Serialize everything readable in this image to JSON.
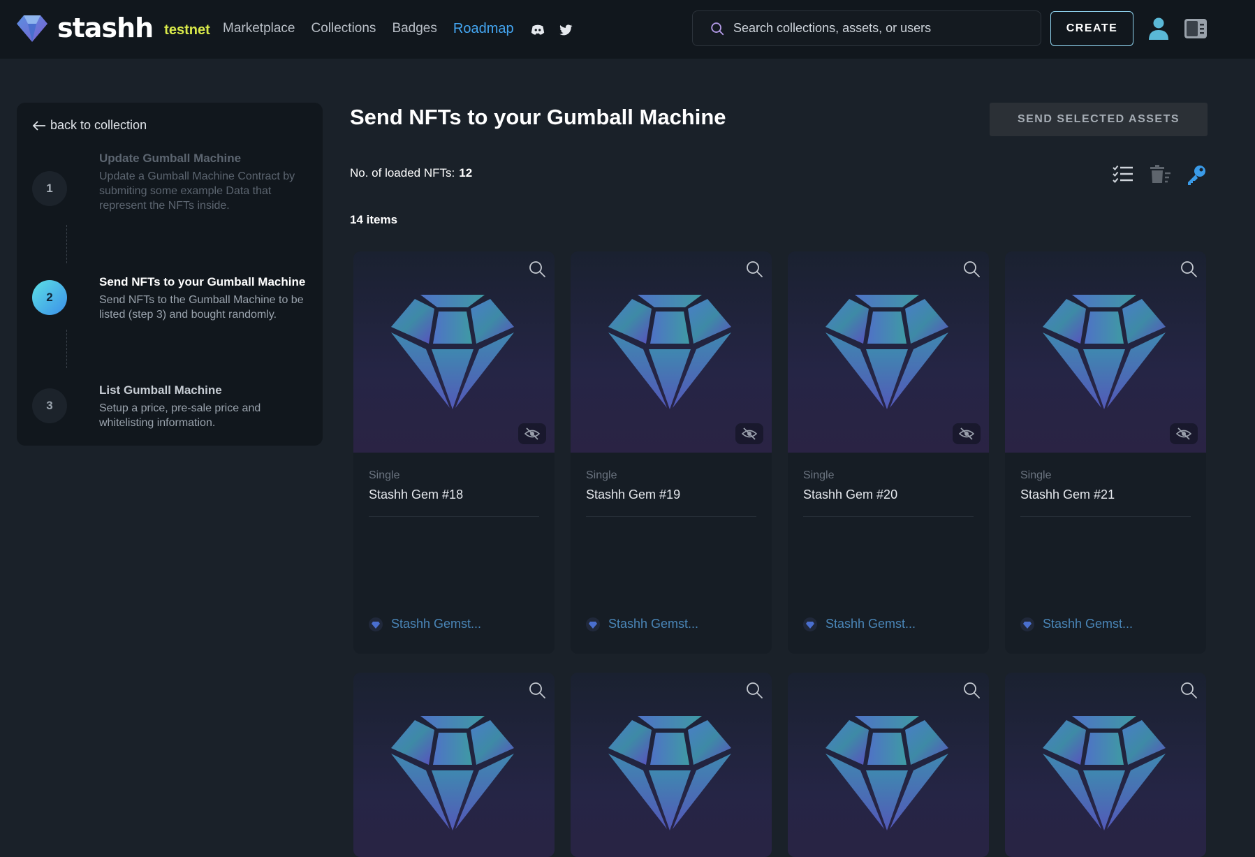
{
  "header": {
    "logo_word": "stashh",
    "network": "testnet",
    "nav": [
      {
        "label": "Marketplace"
      },
      {
        "label": "Collections"
      },
      {
        "label": "Badges"
      },
      {
        "label": "Roadmap"
      }
    ],
    "search_placeholder": "Search collections, assets, or users",
    "create_label": "CREATE"
  },
  "sidebar": {
    "back_label": "back to collection",
    "steps": [
      {
        "number": "1",
        "title": "Update Gumball Machine",
        "desc": "Update a Gumball Machine Contract by submiting some example Data that represent the NFTs inside.",
        "state": "done"
      },
      {
        "number": "2",
        "title": "Send NFTs to your Gumball Machine",
        "desc": "Send NFTs to the Gumball Machine to be listed (step 3) and bought randomly.",
        "state": "active"
      },
      {
        "number": "3",
        "title": "List Gumball Machine",
        "desc": "Setup a price, pre-sale price and whitelisting information.",
        "state": "upcoming"
      }
    ]
  },
  "main": {
    "title": "Send NFTs to your Gumball Machine",
    "send_label": "SEND SELECTED ASSETS",
    "loaded_label": "No. of loaded NFTs:",
    "loaded_count": "12",
    "items_count": "14 items",
    "toolbar_icons": [
      "checklist-icon",
      "delete-filter-icon",
      "key-icon"
    ]
  },
  "cards": [
    {
      "type": "Single",
      "name": "Stashh Gem #18",
      "collection": "Stashh Gemst..."
    },
    {
      "type": "Single",
      "name": "Stashh Gem #19",
      "collection": "Stashh Gemst..."
    },
    {
      "type": "Single",
      "name": "Stashh Gem #20",
      "collection": "Stashh Gemst..."
    },
    {
      "type": "Single",
      "name": "Stashh Gem #21",
      "collection": "Stashh Gemst..."
    },
    {
      "type": "",
      "name": "",
      "collection": ""
    },
    {
      "type": "",
      "name": "",
      "collection": ""
    },
    {
      "type": "",
      "name": "",
      "collection": ""
    },
    {
      "type": "",
      "name": "",
      "collection": ""
    }
  ],
  "colors": {
    "accent_blue": "#44a6f2",
    "testnet_yellow": "#d9e94a",
    "active_step": "#4fc3e8"
  }
}
